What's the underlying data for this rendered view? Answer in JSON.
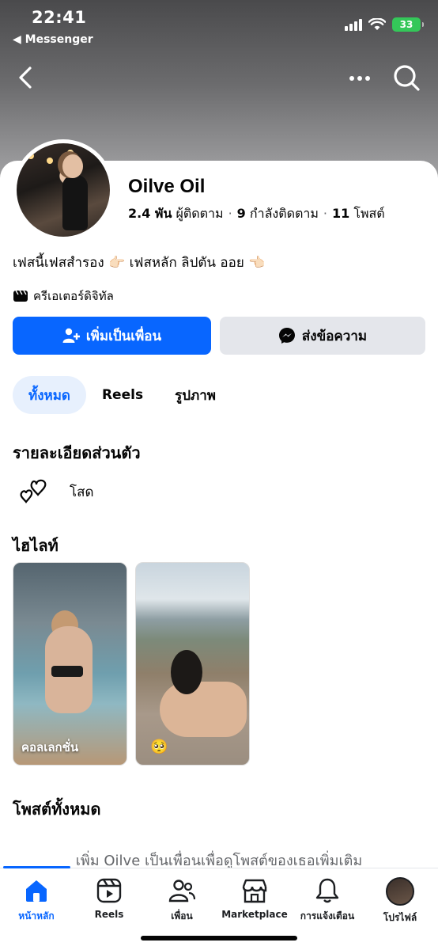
{
  "status_bar": {
    "time": "22:41",
    "back_app": "◀ Messenger",
    "battery": "33"
  },
  "profile": {
    "name": "Oilve Oil",
    "followers_count": "2.4 พัน",
    "followers_label": "ผู้ติดตาม",
    "following_count": "9",
    "following_label": "กำลังติดตาม",
    "posts_count": "11",
    "posts_label": "โพสต์",
    "bio": "เฟสนี้เฟสสำรอง 👉🏻 เฟสหลัก ลิปตัน ออย 👈🏻",
    "category": "ครีเอเตอร์ดิจิทัล"
  },
  "actions": {
    "add_friend": "เพิ่มเป็นเพื่อน",
    "message": "ส่งข้อความ"
  },
  "tabs": [
    "ทั้งหมด",
    "Reels",
    "รูปภาพ"
  ],
  "details": {
    "title": "รายละเอียดส่วนตัว",
    "relationship": "โสด"
  },
  "highlights": {
    "title": "ไฮไลท์",
    "items": [
      {
        "label": "คอลเลกชั่น"
      },
      {
        "label": "🥺"
      }
    ]
  },
  "posts": {
    "title": "โพสต์ทั้งหมด",
    "add_friend_prompt": "เพิ่ม Oilve เป็นเพื่อนเพื่อดูโพสต์ของเธอเพิ่มเติม"
  },
  "bottom_nav": [
    {
      "label": "หน้าหลัก",
      "icon": "home-icon"
    },
    {
      "label": "Reels",
      "icon": "reels-icon"
    },
    {
      "label": "เพื่อน",
      "icon": "friends-icon"
    },
    {
      "label": "Marketplace",
      "icon": "marketplace-icon"
    },
    {
      "label": "การแจ้งเตือน",
      "icon": "bell-icon"
    },
    {
      "label": "โปรไฟล์",
      "icon": "profile-avatar"
    }
  ],
  "colors": {
    "accent": "#0866ff",
    "secondary_button": "#e4e6eb",
    "active_tab_bg": "#e7f0fd",
    "battery": "#34c759"
  }
}
